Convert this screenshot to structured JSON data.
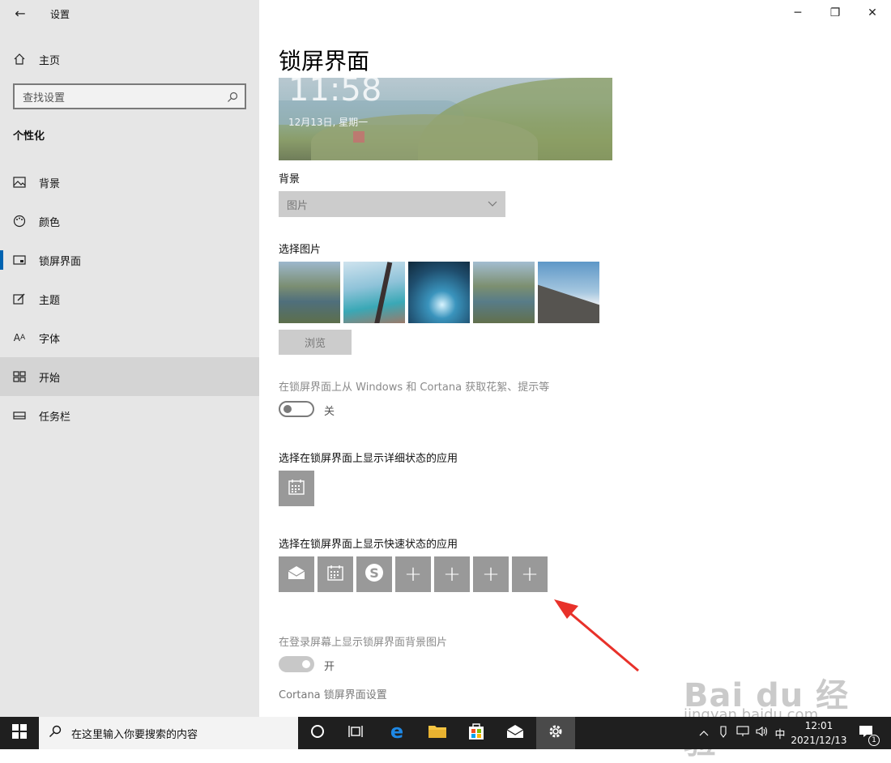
{
  "window": {
    "title": "设置",
    "controls": {
      "minimize": "─",
      "maximize": "❐",
      "close": "✕"
    }
  },
  "sidebar": {
    "home_label": "主页",
    "search_placeholder": "查找设置",
    "section_label": "个性化",
    "items": [
      {
        "label": "背景",
        "icon": "image-icon"
      },
      {
        "label": "颜色",
        "icon": "palette-icon"
      },
      {
        "label": "锁屏界面",
        "icon": "lockscreen-icon"
      },
      {
        "label": "主题",
        "icon": "theme-icon"
      },
      {
        "label": "字体",
        "icon": "font-icon"
      },
      {
        "label": "开始",
        "icon": "start-icon"
      },
      {
        "label": "任务栏",
        "icon": "taskbar-icon"
      }
    ]
  },
  "main": {
    "page_title": "锁屏界面",
    "preview": {
      "time": "11:58",
      "date": "12月13日, 星期一"
    },
    "background_label": "背景",
    "background_value": "图片",
    "choose_picture_label": "选择图片",
    "browse_label": "浏览",
    "fun_facts_label": "在锁屏界面上从 Windows 和 Cortana 获取花絮、提示等",
    "fun_facts_state": "关",
    "detailed_status_label": "选择在锁屏界面上显示详细状态的应用",
    "quick_status_label": "选择在锁屏界面上显示快速状态的应用",
    "signin_bg_label": "在登录屏幕上显示锁屏界面背景图片",
    "signin_bg_state": "开",
    "cortana_settings_label": "Cortana 锁屏界面设置"
  },
  "taskbar": {
    "search_placeholder": "在这里输入你要搜索的内容",
    "ime": "中",
    "time": "12:01",
    "date": "2021/12/13",
    "notification_count": "1"
  },
  "watermark": {
    "logo": "Bai du 经验",
    "url": "jingyan.baidu.com"
  },
  "colors": {
    "accent": "#0063b1",
    "sidebar_bg": "#e6e6e6",
    "taskbar_bg": "#1f1f1f",
    "arrow": "#e8312a"
  }
}
